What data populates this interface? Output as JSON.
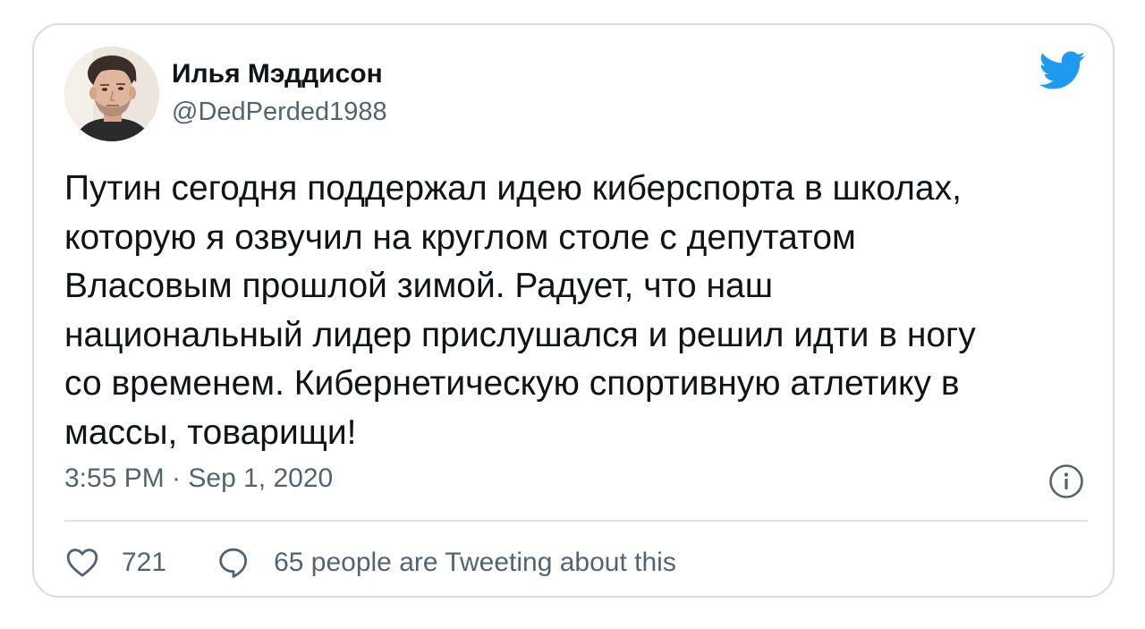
{
  "author": {
    "name": "Илья Мэддисон",
    "handle": "@DedPerded1988"
  },
  "tweet": {
    "lines": [
      "Путин сегодня поддержал идею киберспорта в школах,",
      "которую я озвучил на круглом столе с депутатом",
      "Власовым прошлой зимой. Радует, что наш",
      "национальный лидер прислушался и решил идти в ногу",
      "со временем. Кибернетическую спортивную атлетику в",
      "массы, товарищи!"
    ],
    "timestamp": "3:55 PM · Sep 1, 2020"
  },
  "actions": {
    "likes": "721",
    "conversation": "65 people are Tweeting about this"
  },
  "icons": {
    "brand": "twitter-bird-icon",
    "info": "info-icon",
    "like": "heart-icon",
    "reply": "speech-bubble-icon"
  },
  "colors": {
    "brand": "#1d9bf0",
    "text": "#0f1419",
    "secondary": "#536471",
    "border": "#d6dde3"
  }
}
